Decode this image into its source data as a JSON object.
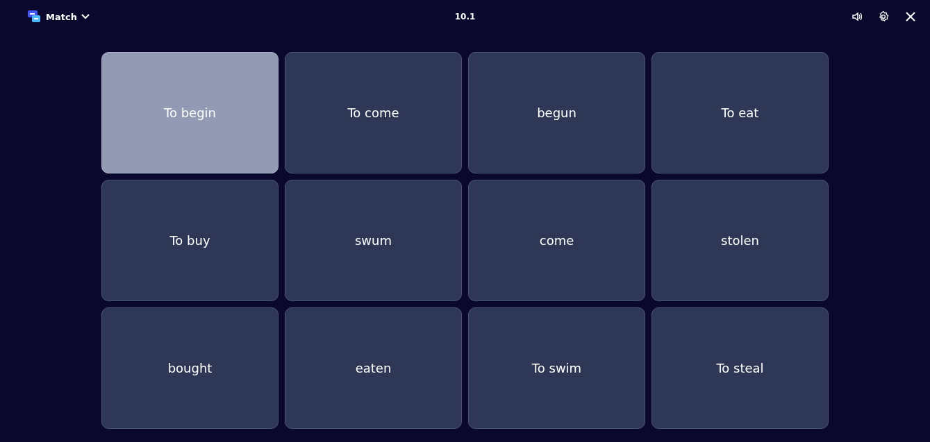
{
  "header": {
    "mode": "Match",
    "timer": "10.1"
  },
  "cards": [
    {
      "text": "To begin",
      "selected": true
    },
    {
      "text": "To come",
      "selected": false
    },
    {
      "text": "begun",
      "selected": false
    },
    {
      "text": "To eat",
      "selected": false
    },
    {
      "text": "To buy",
      "selected": false
    },
    {
      "text": "swum",
      "selected": false
    },
    {
      "text": "come",
      "selected": false
    },
    {
      "text": "stolen",
      "selected": false
    },
    {
      "text": "bought",
      "selected": false
    },
    {
      "text": "eaten",
      "selected": false
    },
    {
      "text": "To swim",
      "selected": false
    },
    {
      "text": "To steal",
      "selected": false
    }
  ]
}
